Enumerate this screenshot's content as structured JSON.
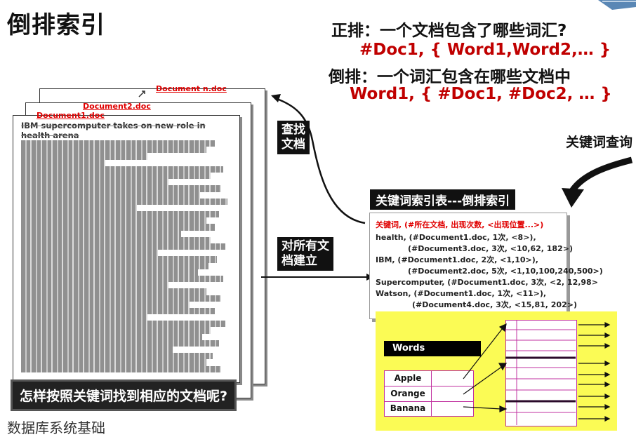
{
  "title": "倒排索引",
  "definitions": {
    "forward_label": "正排：一个文档包含了哪些词汇?",
    "forward_example": "#Doc1, { Word1,Word2,… }",
    "inverted_label": "倒排：一个词汇包含在哪些文档中",
    "inverted_example": "Word1, { #Doc1, #Doc2, … }"
  },
  "documents": {
    "names": [
      "Document n.doc",
      "Document2.doc",
      "Document1.doc"
    ],
    "headline": "IBM supercomputer takes on new role in health arena"
  },
  "labels": {
    "find_docs": [
      "查找",
      "文档"
    ],
    "build_all": [
      "对所有文",
      "档建立"
    ],
    "keyword_query": "关键词查询"
  },
  "index_table": {
    "title": "关键词索引表---倒排索引",
    "rows": [
      "关键词, (#所在文档, 出现次数, <出现位置...>)",
      "health, (#Document1.doc, 1次, <8>),",
      "(#Document3.doc, 3次, <10,62, 182>)",
      "IBM,    (#Document1.doc, 2次, <1,10>),",
      "(#Document2.doc, 5次, <1,10,100,240,500>)",
      "Supercomputer, (#Document1.doc, 3次, <2, 12,98>",
      "Watson, (#Document1.doc, 1次, <11>),",
      "(#Document4.doc, 3次, <15,81, 202>)"
    ]
  },
  "words_structure": {
    "header": "Words",
    "words": [
      "Apple",
      "Orange",
      "Banana"
    ]
  },
  "question": "怎样按照关键词找到相应的文档呢?",
  "footer": "数据库系统基础"
}
